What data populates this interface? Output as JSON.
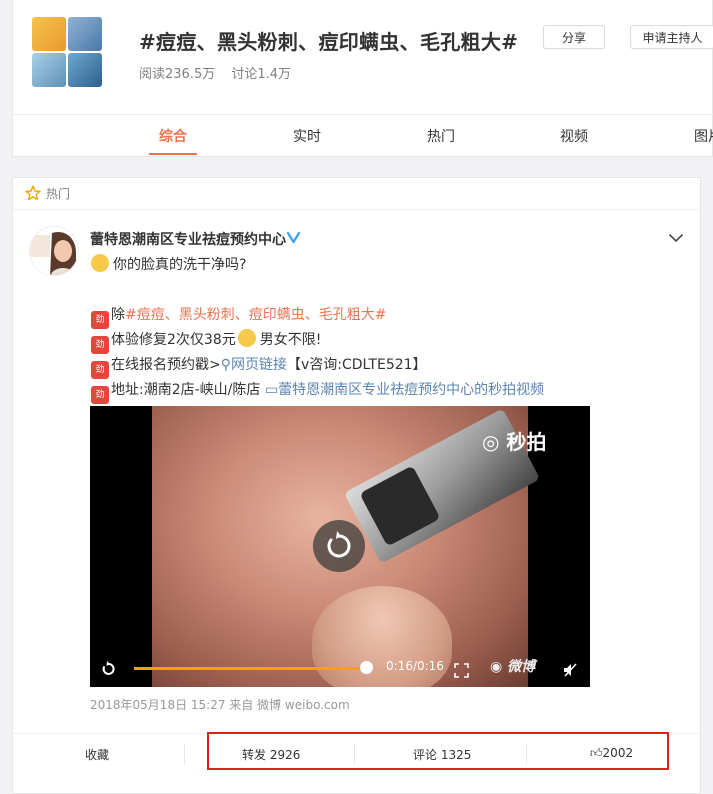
{
  "topic": {
    "title": "#痘痘、黑头粉刺、痘印螨虫、毛孔粗大#",
    "reads": "阅读236.5万",
    "discussions": "讨论1.4万",
    "share_label": "分享",
    "host_label": "申请主持人"
  },
  "tabs": [
    {
      "label": "综合",
      "active": true
    },
    {
      "label": "实时",
      "active": false
    },
    {
      "label": "热门",
      "active": false
    },
    {
      "label": "视频",
      "active": false
    },
    {
      "label": "图片",
      "active": false
    }
  ],
  "feed": {
    "section_label": "热门",
    "post": {
      "author": "蕾特恩潮南区专业祛痘预约中心",
      "line1": "你的脸真的洗干净吗?",
      "line2_prefix": "除",
      "line2_tag": "#痘痘、黑头粉刺、痘印螨虫、毛孔粗大#",
      "line3_a": "体验修复2次仅38元",
      "line3_b": "男女不限!",
      "line4_a": "在线报名预约戳>",
      "line4_link": "网页链接",
      "line4_b": "【v咨询:CDLTE521】",
      "line5_a": "地址:潮南2店-峡山/陈店",
      "line5_link": "蕾特恩潮南区专业祛痘预约中心的秒拍视频",
      "video": {
        "brand": "秒拍",
        "time": "0:16/0:16",
        "watermark": "微博",
        "progress": 1.0
      },
      "meta": "2018年05月18日 15:27  来自 微博 weibo.com",
      "actions": {
        "favorite": "收藏",
        "repost": "转发 2926",
        "comment": "评论 1325",
        "like": "2002"
      }
    }
  },
  "colors": {
    "accent": "#eb7350",
    "link": "#5d84b0",
    "highlight": "#e02020"
  }
}
